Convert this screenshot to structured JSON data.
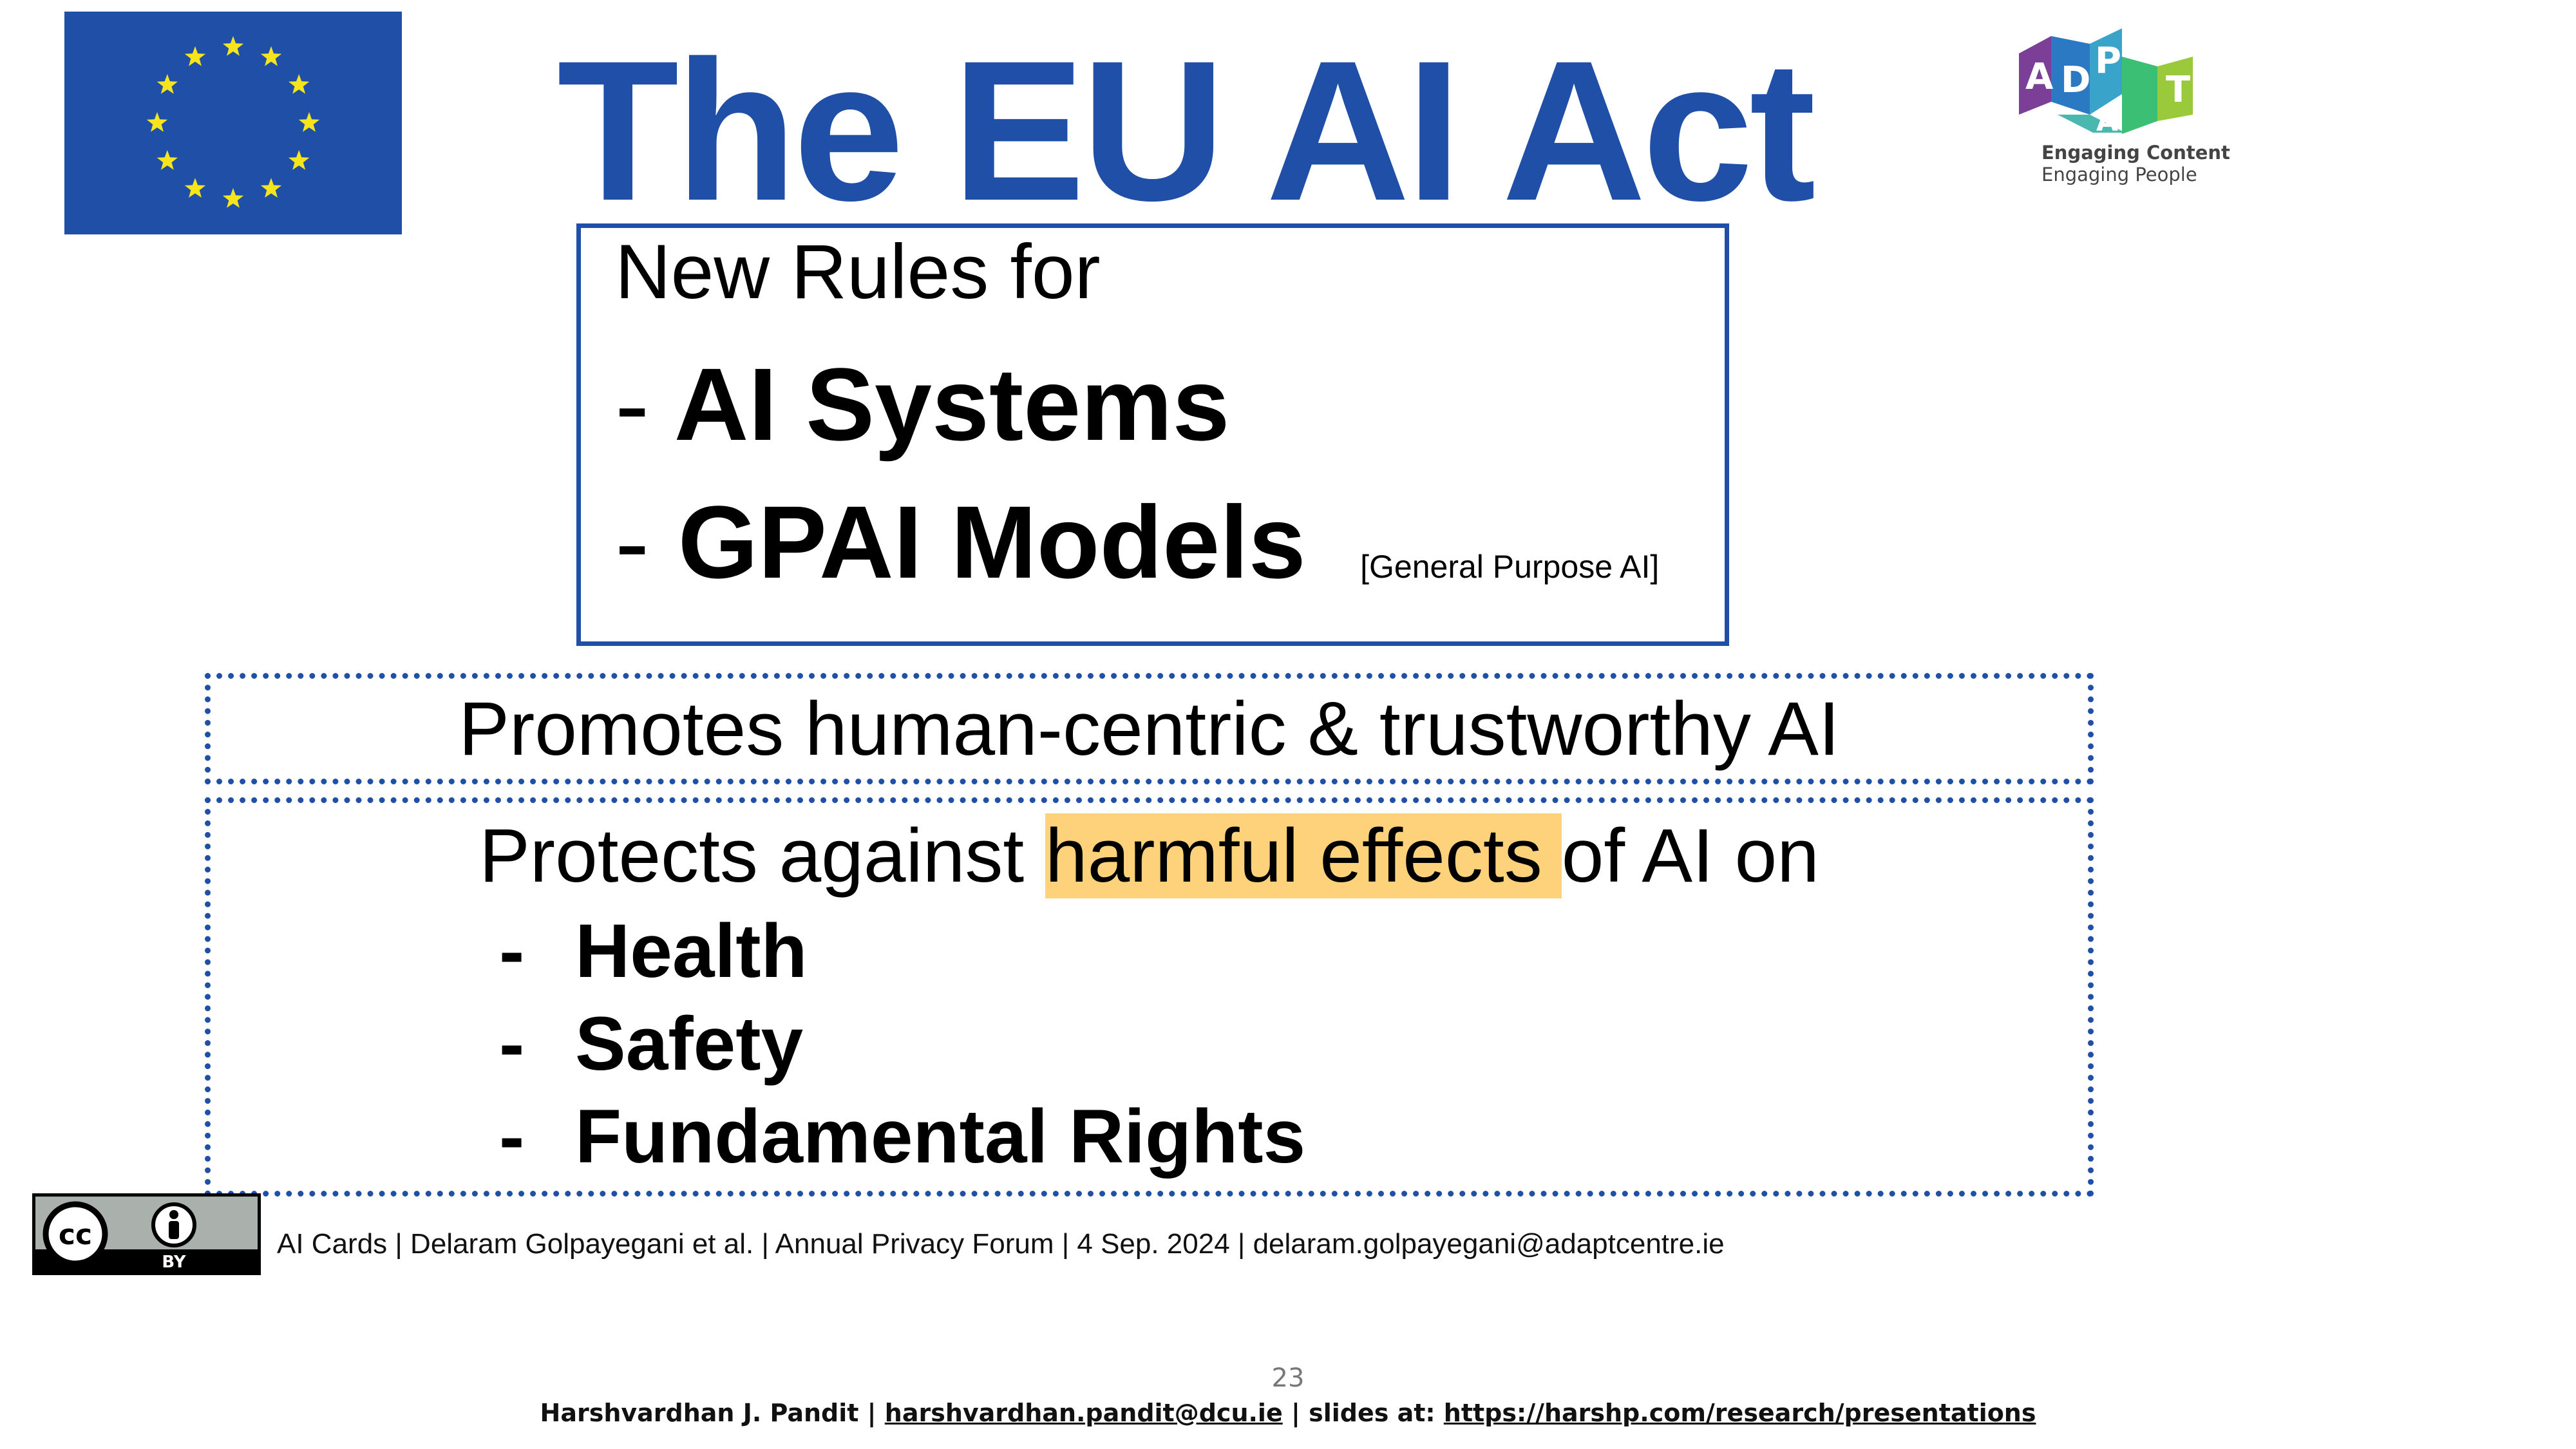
{
  "slide": {
    "title": "The EU AI Act",
    "rules_box": {
      "heading": "New Rules for",
      "items": [
        {
          "dash": "-",
          "label": "AI Systems"
        },
        {
          "dash": "-",
          "label": "GPAI Models",
          "note": "[General Purpose AI]"
        }
      ]
    },
    "promotes": "Promotes human-centric & trustworthy AI",
    "protects": {
      "prefix": "Protects against",
      "highlight": "harmful effects",
      "suffix": "of AI on",
      "items": [
        {
          "dash": "-",
          "label": "Health"
        },
        {
          "dash": "-",
          "label": "Safety"
        },
        {
          "dash": "-",
          "label": "Fundamental Rights"
        }
      ]
    },
    "citation": "AI Cards | Delaram Golpayegani et al. | Annual Privacy Forum | 4 Sep. 2024 | delaram.golpayegani@adaptcentre.ie",
    "license": {
      "icon": "cc-by-icon",
      "label": "BY"
    }
  },
  "logos": {
    "eu_flag": {
      "icon": "eu-flag-icon",
      "background": "#1f4fa6",
      "star_color": "#f6e51c"
    },
    "adapt": {
      "icon": "adapt-logo-icon",
      "letters": [
        "A",
        "D",
        "P",
        "A",
        "T"
      ],
      "tagline_1": "Engaging Content",
      "tagline_2": "Engaging People"
    }
  },
  "page_number": "23",
  "footer": {
    "author": "Harshvardhan J. Pandit",
    "sep_1": " | ",
    "email": "harshvardhan.pandit@dcu.ie",
    "sep_2": " | slides at: ",
    "slides_url": "https://harshp.com/research/presentations"
  },
  "colors": {
    "accent_blue": "#1f4fa6",
    "highlight": "#fdd27a"
  }
}
